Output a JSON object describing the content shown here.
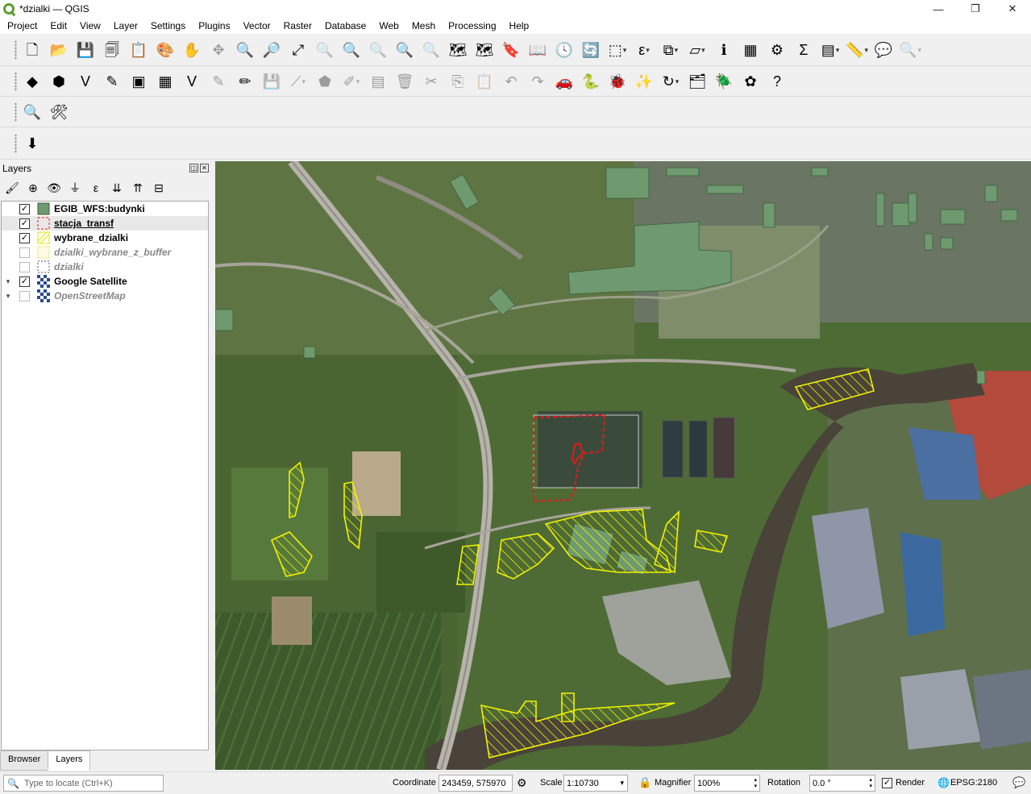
{
  "window": {
    "title": "*dzialki — QGIS",
    "min_glyph": "—",
    "max_glyph": "❐",
    "close_glyph": "✕"
  },
  "menu": [
    "Project",
    "Edit",
    "View",
    "Layer",
    "Settings",
    "Plugins",
    "Vector",
    "Raster",
    "Database",
    "Web",
    "Mesh",
    "Processing",
    "Help"
  ],
  "toolbar1": [
    {
      "name": "new-project-icon",
      "g": "🗋"
    },
    {
      "name": "open-project-icon",
      "g": "📂"
    },
    {
      "name": "save-project-icon",
      "g": "💾"
    },
    {
      "name": "new-print-layout-icon",
      "g": "🗐"
    },
    {
      "name": "layout-manager-icon",
      "g": "📋"
    },
    {
      "name": "style-manager-icon",
      "g": "🎨"
    },
    {
      "name": "pan-map-icon",
      "g": "✋"
    },
    {
      "name": "pan-to-selection-icon",
      "g": "✥",
      "dis": true
    },
    {
      "name": "zoom-in-icon",
      "g": "🔍"
    },
    {
      "name": "zoom-out-icon",
      "g": "🔎"
    },
    {
      "name": "zoom-full-icon",
      "g": "⤢"
    },
    {
      "name": "zoom-to-selection-icon",
      "g": "🔍",
      "dis": true
    },
    {
      "name": "zoom-to-layer-icon",
      "g": "🔍"
    },
    {
      "name": "zoom-native-icon",
      "g": "🔍",
      "dis": true
    },
    {
      "name": "zoom-last-icon",
      "g": "🔍"
    },
    {
      "name": "zoom-next-icon",
      "g": "🔍",
      "dis": true
    },
    {
      "name": "new-map-view-icon",
      "g": "🗺"
    },
    {
      "name": "new-3d-map-view-icon",
      "g": "🗺"
    },
    {
      "name": "new-bookmark-icon",
      "g": "🔖"
    },
    {
      "name": "show-bookmarks-icon",
      "g": "📖"
    },
    {
      "name": "temporal-controller-icon",
      "g": "🕓"
    },
    {
      "name": "refresh-icon",
      "g": "🔄"
    },
    {
      "name": "select-features-icon",
      "g": "⬚",
      "dd": true
    },
    {
      "name": "select-by-expression-icon",
      "g": "ε",
      "dd": true
    },
    {
      "name": "deselect-features-icon",
      "g": "⧉",
      "dd": true
    },
    {
      "name": "select-by-location-icon",
      "g": "▱",
      "dd": true
    },
    {
      "name": "identify-features-icon",
      "g": "ℹ"
    },
    {
      "name": "attribute-table-icon",
      "g": "▦"
    },
    {
      "name": "toolbox-icon",
      "g": "⚙"
    },
    {
      "name": "statistics-icon",
      "g": "Σ"
    },
    {
      "name": "open-field-calculator-icon",
      "g": "▤",
      "dd": true
    },
    {
      "name": "measure-line-icon",
      "g": "📏",
      "dd": true
    },
    {
      "name": "map-tips-icon",
      "g": "💬"
    },
    {
      "name": "locator-search-icon",
      "g": "🔍",
      "dis": true,
      "dd": true
    }
  ],
  "toolbar2": [
    {
      "name": "data-source-manager-icon",
      "g": "◆"
    },
    {
      "name": "new-geopackage-layer-icon",
      "g": "⬢"
    },
    {
      "name": "new-shapefile-layer-icon",
      "g": "V"
    },
    {
      "name": "new-temporary-layer-icon",
      "g": "✎"
    },
    {
      "name": "new-spatialite-layer-icon",
      "g": "▣"
    },
    {
      "name": "new-virtual-layer-icon",
      "g": "▦"
    },
    {
      "name": "add-wms-layer-icon",
      "g": "V"
    },
    {
      "name": "current-edits-icon",
      "g": "✎",
      "dis": true
    },
    {
      "name": "toggle-editing-icon",
      "g": "✏"
    },
    {
      "name": "save-edits-icon",
      "g": "💾",
      "dis": true
    },
    {
      "name": "digitize-line-icon",
      "g": "⟋",
      "dis": true,
      "dd": true
    },
    {
      "name": "add-feature-icon",
      "g": "⬟",
      "dis": true
    },
    {
      "name": "vertex-tool-icon",
      "g": "✐",
      "dis": true,
      "dd": true
    },
    {
      "name": "modify-attributes-icon",
      "g": "▤",
      "dis": true
    },
    {
      "name": "delete-selected-icon",
      "g": "🗑",
      "dis": true
    },
    {
      "name": "cut-features-icon",
      "g": "✂",
      "dis": true
    },
    {
      "name": "copy-features-icon",
      "g": "⎘",
      "dis": true
    },
    {
      "name": "paste-features-icon",
      "g": "📋",
      "dis": true
    },
    {
      "name": "undo-icon",
      "g": "↶",
      "dis": true
    },
    {
      "name": "redo-icon",
      "g": "↷",
      "dis": true
    },
    {
      "name": "gps-plugin-icon",
      "g": "🚗"
    },
    {
      "name": "python-console-icon",
      "g": "🐍"
    },
    {
      "name": "debug-plugin-icon",
      "g": "🐞"
    },
    {
      "name": "magic-wand-icon",
      "g": "✨"
    },
    {
      "name": "rotate-plugin-icon",
      "g": "↻",
      "dd": true
    },
    {
      "name": "layer-stack-icon",
      "g": "🗂"
    },
    {
      "name": "plugin-bug-icon",
      "g": "🪲"
    },
    {
      "name": "plugin-flower-icon",
      "g": "✿"
    },
    {
      "name": "help-icon",
      "g": "?"
    }
  ],
  "toolbar3": [
    {
      "name": "locate-plugin-icon",
      "g": "🔍"
    },
    {
      "name": "tools-plugin-icon",
      "g": "🛠"
    }
  ],
  "toolbar4": [
    {
      "name": "download-plugin-icon",
      "g": "⬇"
    }
  ],
  "layers": {
    "title": "Layers",
    "float_glyph": "◫",
    "close_glyph": "✕",
    "tools": [
      {
        "name": "open-layer-styling-icon",
        "g": "🖌"
      },
      {
        "name": "add-group-icon",
        "g": "⊕"
      },
      {
        "name": "manage-visibility-icon",
        "g": "👁"
      },
      {
        "name": "filter-legend-icon",
        "g": "⏚"
      },
      {
        "name": "filter-by-expression-icon",
        "g": "ε"
      },
      {
        "name": "expand-all-icon",
        "g": "⇊"
      },
      {
        "name": "collapse-all-icon",
        "g": "⇈"
      },
      {
        "name": "remove-layer-icon",
        "g": "⊟"
      }
    ],
    "items": [
      {
        "name": "EGIB_WFS:budynki",
        "checked": true,
        "symbol": "fill-green",
        "style": "bold"
      },
      {
        "name": "stacja_transf",
        "checked": true,
        "symbol": "dash-red",
        "style": "underline",
        "selected": true
      },
      {
        "name": "wybrane_dzialki",
        "checked": true,
        "symbol": "hatch-yellow",
        "style": "bold"
      },
      {
        "name": "dzialki_wybrane_z_buffer",
        "checked": false,
        "symbol": "plain-yellow",
        "style": "italic"
      },
      {
        "name": "dzialki",
        "checked": false,
        "symbol": "dash-black",
        "style": "italic"
      },
      {
        "name": "Google Satellite",
        "checked": true,
        "symbol": "raster",
        "style": "bold",
        "expander": "▾"
      },
      {
        "name": "OpenStreetMap",
        "checked": false,
        "symbol": "raster",
        "style": "italic",
        "expander": "▾"
      }
    ],
    "check_glyph": "✓",
    "tabs": [
      "Browser",
      "Layers"
    ],
    "active_tab": "Layers"
  },
  "status": {
    "locate_placeholder": "Type to locate (Ctrl+K)",
    "coordinate_label": "Coordinate",
    "coordinate_value": "243459, 575970",
    "scale_label": "Scale",
    "scale_value": "1:10730",
    "magnifier_label": "Magnifier",
    "magnifier_value": "100%",
    "rotation_label": "Rotation",
    "rotation_value": "0.0 °",
    "render_label": "Render",
    "render_checked": true,
    "crs": "EPSG:2180",
    "messages_glyph": "💬"
  },
  "colors": {
    "building": "#6f9a6f",
    "selected_parcel": "#ffff00",
    "station": "#e31a1c",
    "river": "#4a4339"
  }
}
